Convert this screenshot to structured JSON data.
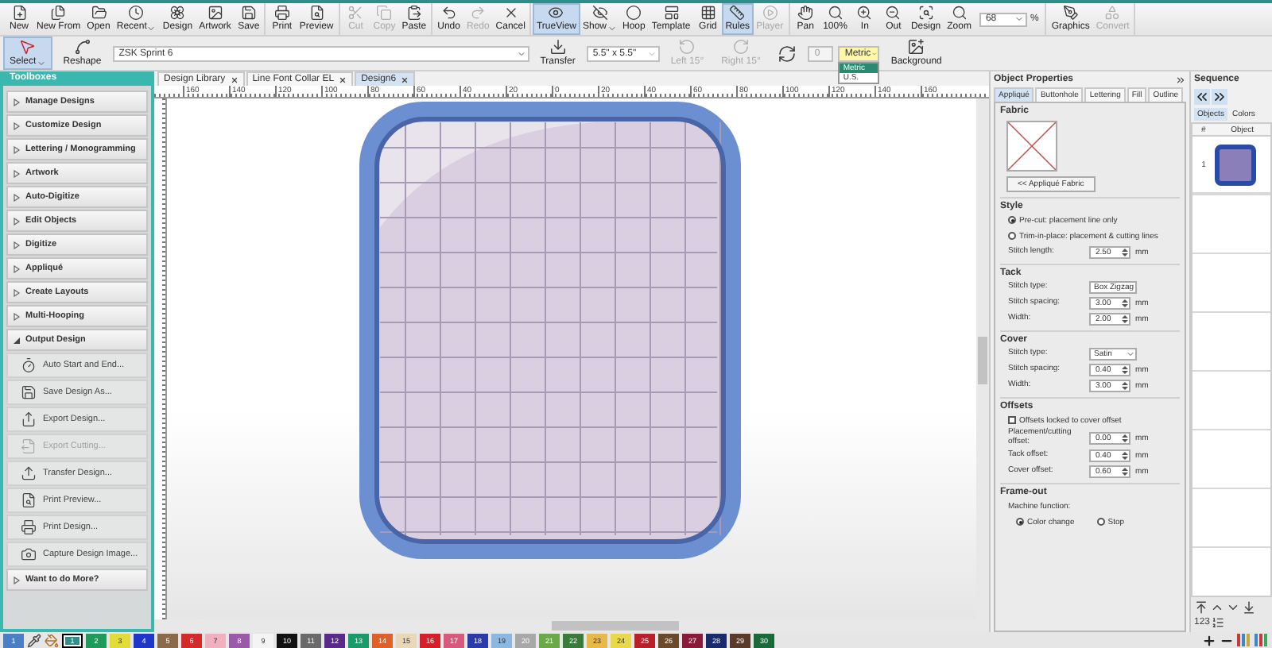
{
  "toolbar": {
    "groups": [
      [
        {
          "kind": "button",
          "label": "New",
          "disabled": false,
          "on": false,
          "menu": false
        },
        {
          "kind": "button",
          "label": "New From",
          "disabled": false,
          "on": false,
          "menu": false
        },
        {
          "kind": "button",
          "label": "Open",
          "disabled": false,
          "on": false,
          "menu": false
        },
        {
          "kind": "button",
          "label": "Recent",
          "disabled": false,
          "on": false,
          "menu": true
        },
        {
          "kind": "button",
          "label": "Design",
          "disabled": false,
          "on": false,
          "menu": false
        },
        {
          "kind": "button",
          "label": "Artwork",
          "disabled": false,
          "on": false,
          "menu": false
        },
        {
          "kind": "button",
          "label": "Save",
          "disabled": false,
          "on": false,
          "menu": false
        }
      ],
      [
        {
          "kind": "button",
          "label": "Print",
          "disabled": false,
          "on": false,
          "menu": false
        },
        {
          "kind": "button",
          "label": "Preview",
          "disabled": false,
          "on": false,
          "menu": false
        }
      ],
      [
        {
          "kind": "button",
          "label": "Cut",
          "disabled": true,
          "on": false,
          "menu": false
        },
        {
          "kind": "button",
          "label": "Copy",
          "disabled": true,
          "on": false,
          "menu": false
        },
        {
          "kind": "button",
          "label": "Paste",
          "disabled": false,
          "on": false,
          "menu": false
        }
      ],
      [
        {
          "kind": "button",
          "label": "Undo",
          "disabled": false,
          "on": false,
          "menu": false
        },
        {
          "kind": "button",
          "label": "Redo",
          "disabled": true,
          "on": false,
          "menu": false
        },
        {
          "kind": "button",
          "label": "Cancel",
          "disabled": false,
          "on": false,
          "menu": false
        }
      ],
      [
        {
          "kind": "button",
          "label": "TrueView",
          "disabled": false,
          "on": true,
          "menu": false
        },
        {
          "kind": "button",
          "label": "Show",
          "disabled": false,
          "on": false,
          "menu": true
        },
        {
          "kind": "button",
          "label": "Hoop",
          "disabled": false,
          "on": false,
          "menu": false
        },
        {
          "kind": "button",
          "label": "Template",
          "disabled": false,
          "on": false,
          "menu": false
        },
        {
          "kind": "button",
          "label": "Grid",
          "disabled": false,
          "on": false,
          "menu": false
        },
        {
          "kind": "button",
          "label": "Rules",
          "disabled": false,
          "on": true,
          "menu": false
        },
        {
          "kind": "button",
          "label": "Player",
          "disabled": true,
          "on": false,
          "menu": false
        }
      ],
      [
        {
          "kind": "button",
          "label": "Pan",
          "disabled": false,
          "on": false,
          "menu": false
        },
        {
          "kind": "button",
          "label": "100%",
          "disabled": false,
          "on": false,
          "menu": false
        },
        {
          "kind": "button",
          "label": "In",
          "disabled": false,
          "on": false,
          "menu": false
        },
        {
          "kind": "button",
          "label": "Out",
          "disabled": false,
          "on": false,
          "menu": false
        },
        {
          "kind": "button",
          "label": "Design",
          "disabled": false,
          "on": false,
          "menu": false
        },
        {
          "kind": "button",
          "label": "Zoom",
          "disabled": false,
          "on": false,
          "menu": false
        },
        {
          "kind": "combo",
          "value": "68",
          "unit": "%"
        }
      ],
      [
        {
          "kind": "button",
          "label": "Graphics",
          "disabled": false,
          "on": false,
          "menu": false
        },
        {
          "kind": "button",
          "label": "Convert",
          "disabled": true,
          "on": false,
          "menu": false
        }
      ]
    ]
  },
  "tool_bar": [
    {
      "kind": "tool",
      "label": "Select",
      "on": true,
      "disabled": false,
      "menu": true
    },
    {
      "kind": "tool",
      "label": "Reshape",
      "on": false,
      "disabled": false,
      "menu": false
    },
    {
      "kind": "machine_select",
      "value": "ZSK Sprint 6"
    },
    {
      "kind": "tool",
      "label": "Transfer",
      "on": false,
      "disabled": false,
      "menu": false
    },
    {
      "kind": "hoop_select",
      "value": "5.5\" x 5.5\""
    },
    {
      "kind": "tool",
      "label": "Left 15°",
      "on": false,
      "disabled": true,
      "menu": false
    },
    {
      "kind": "tool",
      "label": "Right 15°",
      "on": false,
      "disabled": true,
      "menu": false
    },
    {
      "kind": "tool",
      "on": false,
      "disabled": false,
      "menu": false
    },
    {
      "kind": "angle_field",
      "value": "0",
      "disabled": true
    },
    {
      "kind": "units_select",
      "value": "Metric",
      "open": true,
      "options": [
        {
          "label": "Metric",
          "selected": true
        },
        {
          "label": "U.S.",
          "selected": false
        }
      ]
    },
    {
      "kind": "tool",
      "label": "Background",
      "on": false,
      "disabled": false,
      "menu": false
    }
  ],
  "toolboxes": {
    "title": "Toolboxes",
    "items": [
      {
        "label": "Manage Designs",
        "expanded": false
      },
      {
        "label": "Customize Design",
        "expanded": false
      },
      {
        "label": "Lettering / Monogramming",
        "expanded": false
      },
      {
        "label": "Artwork",
        "expanded": false
      },
      {
        "label": "Auto-Digitize",
        "expanded": false
      },
      {
        "label": "Edit Objects",
        "expanded": false
      },
      {
        "label": "Digitize",
        "expanded": false
      },
      {
        "label": "Appliqué",
        "expanded": false
      },
      {
        "label": "Create Layouts",
        "expanded": false
      },
      {
        "label": "Multi-Hooping",
        "expanded": false
      },
      {
        "label": "Output Design",
        "expanded": true,
        "children": [
          {
            "label": "Auto Start and End...",
            "disabled": false
          },
          {
            "label": "Save Design As...",
            "disabled": false
          },
          {
            "label": "Export Design...",
            "disabled": false
          },
          {
            "label": "Export Cutting...",
            "disabled": true
          },
          {
            "label": "Transfer Design...",
            "disabled": false
          },
          {
            "label": "Print Preview...",
            "disabled": false
          },
          {
            "label": "Print Design...",
            "disabled": false
          },
          {
            "label": "Capture Design Image...",
            "disabled": false
          }
        ]
      },
      {
        "label": "Want to do More?",
        "expanded": false
      }
    ]
  },
  "document_tabs": [
    {
      "label": "Design Library",
      "selected": false
    },
    {
      "label": "Line Font Collar EL",
      "selected": false
    },
    {
      "label": "Design6",
      "selected": true
    }
  ],
  "ruler_labels": [
    "160",
    "140",
    "120",
    "100",
    "80",
    "60",
    "40",
    "20",
    "0",
    "20",
    "40",
    "60",
    "80",
    "100",
    "120",
    "140",
    "160"
  ],
  "object_properties": {
    "title": "Object Properties",
    "tabs": [
      {
        "label": "Appliqué",
        "selected": true
      },
      {
        "label": "Buttonhole",
        "selected": false
      },
      {
        "label": "Lettering",
        "selected": false
      },
      {
        "label": "Fill",
        "selected": false
      },
      {
        "label": "Outline",
        "selected": false
      }
    ],
    "fabric": {
      "title": "Fabric",
      "button": "<< Appliqué Fabric"
    },
    "sections": [
      {
        "title": "Style",
        "rows": [
          {
            "kind": "radio",
            "label": "Pre-cut: placement line only",
            "selected": true
          },
          {
            "kind": "radio",
            "label": "Trim-in-place: placement & cutting lines",
            "selected": false
          },
          {
            "kind": "spin",
            "label": "Stitch length:",
            "value": "2.50",
            "unit": "mm"
          }
        ]
      },
      {
        "title": "Tack",
        "rows": [
          {
            "kind": "select",
            "label": "Stitch type:",
            "value": "Box Zigzag"
          },
          {
            "kind": "spin",
            "label": "Stitch spacing:",
            "value": "3.00",
            "unit": "mm"
          },
          {
            "kind": "spin",
            "label": "Width:",
            "value": "2.00",
            "unit": "mm"
          }
        ]
      },
      {
        "title": "Cover",
        "rows": [
          {
            "kind": "select",
            "label": "Stitch type:",
            "value": "Satin"
          },
          {
            "kind": "spin",
            "label": "Stitch spacing:",
            "value": "0.40",
            "unit": "mm"
          },
          {
            "kind": "spin",
            "label": "Width:",
            "value": "3.00",
            "unit": "mm"
          }
        ]
      },
      {
        "title": "Offsets",
        "rows": [
          {
            "kind": "checkbox",
            "label": "Offsets locked to cover offset",
            "checked": false
          },
          {
            "kind": "spin",
            "label": "Placement/cutting offset:",
            "value": "0.00",
            "unit": "mm"
          },
          {
            "kind": "spin",
            "label": "Tack offset:",
            "value": "0.40",
            "unit": "mm"
          },
          {
            "kind": "spin",
            "label": "Cover offset:",
            "value": "0.60",
            "unit": "mm"
          }
        ]
      },
      {
        "title": "Frame-out",
        "rows": [
          {
            "kind": "text",
            "label": "Machine function:"
          },
          {
            "kind": "radios",
            "options": [
              {
                "label": "Color change",
                "selected": true
              },
              {
                "label": "Stop",
                "selected": false
              }
            ]
          }
        ]
      }
    ]
  },
  "sequence": {
    "title": "Sequence",
    "tabs": [
      {
        "label": "Objects",
        "selected": true
      },
      {
        "label": "Colors",
        "selected": false
      }
    ],
    "columns": [
      "#",
      "Object"
    ],
    "rows": [
      {
        "number": "1"
      }
    ],
    "footer_label": "123"
  },
  "palette": {
    "current": {
      "label": "1",
      "color": "#4a7fc4"
    },
    "chips": [
      {
        "label": "1",
        "color": "#2f8f8a",
        "selected": true
      },
      {
        "label": "2",
        "color": "#1f9a5a",
        "selected": false
      },
      {
        "label": "3",
        "color": "#e2dc3a",
        "selected": false
      },
      {
        "label": "4",
        "color": "#2036c8",
        "selected": false
      },
      {
        "label": "5",
        "color": "#8a6a4a",
        "selected": false
      },
      {
        "label": "6",
        "color": "#d42a2a",
        "selected": false
      },
      {
        "label": "7",
        "color": "#f0b0c0",
        "selected": false
      },
      {
        "label": "8",
        "color": "#9a5aa8",
        "selected": false
      },
      {
        "label": "9",
        "color": "#f4f4f4",
        "selected": false
      },
      {
        "label": "10",
        "color": "#111111",
        "selected": false
      },
      {
        "label": "11",
        "color": "#6a6a6a",
        "selected": false
      },
      {
        "label": "12",
        "color": "#5a2a8a",
        "selected": false
      },
      {
        "label": "13",
        "color": "#1a9a6a",
        "selected": false
      },
      {
        "label": "14",
        "color": "#e0602a",
        "selected": false
      },
      {
        "label": "15",
        "color": "#e8d8b8",
        "selected": false
      },
      {
        "label": "16",
        "color": "#d4202a",
        "selected": false
      },
      {
        "label": "17",
        "color": "#d85a7a",
        "selected": false
      },
      {
        "label": "18",
        "color": "#2a3aa8",
        "selected": false
      },
      {
        "label": "19",
        "color": "#8ab8e0",
        "selected": false
      },
      {
        "label": "20",
        "color": "#a8a8a8",
        "selected": false
      },
      {
        "label": "21",
        "color": "#6aa84a",
        "selected": false
      },
      {
        "label": "22",
        "color": "#3a7a3a",
        "selected": false
      },
      {
        "label": "23",
        "color": "#e8b84a",
        "selected": false
      },
      {
        "label": "24",
        "color": "#e8d84a",
        "selected": false
      },
      {
        "label": "25",
        "color": "#b8202a",
        "selected": false
      },
      {
        "label": "26",
        "color": "#6a4a2a",
        "selected": false
      },
      {
        "label": "27",
        "color": "#8a1a3a",
        "selected": false
      },
      {
        "label": "28",
        "color": "#1a2a6a",
        "selected": false
      },
      {
        "label": "29",
        "color": "#5a3a2a",
        "selected": false
      },
      {
        "label": "30",
        "color": "#1a6a3a",
        "selected": false
      }
    ]
  }
}
